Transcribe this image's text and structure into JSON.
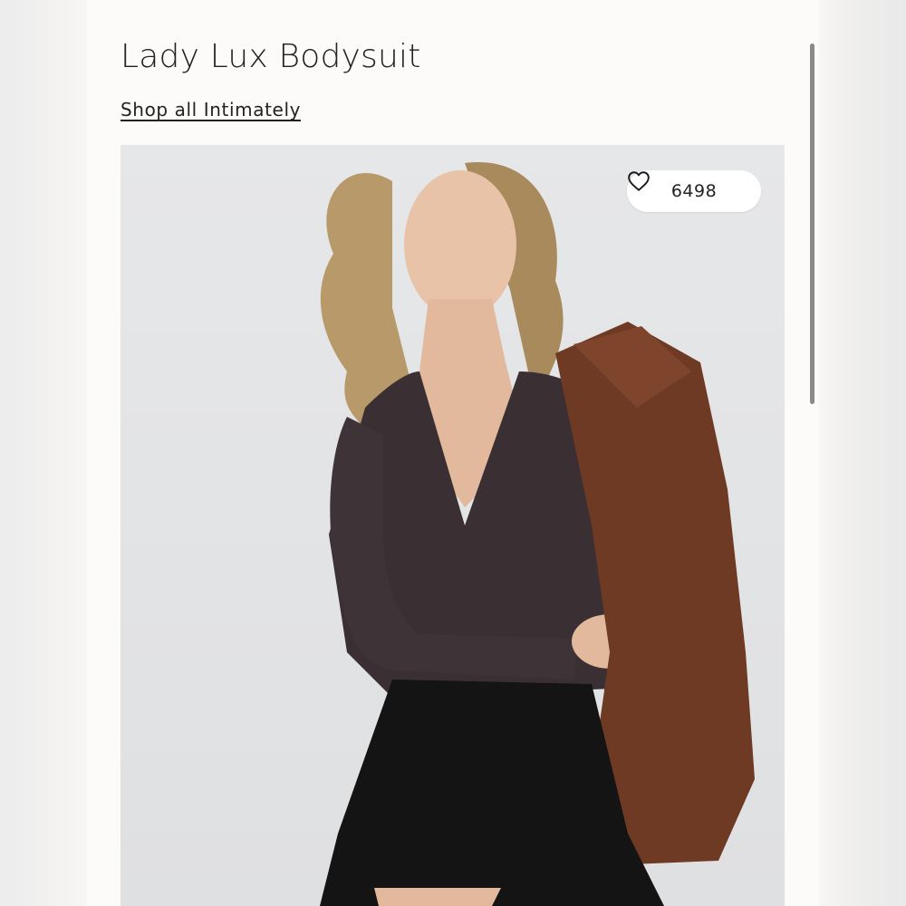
{
  "product": {
    "title": "Lady Lux Bodysuit",
    "shop_link": "Shop all Intimately",
    "likes": "6498"
  },
  "icons": {
    "like": "heart-outline-icon"
  }
}
